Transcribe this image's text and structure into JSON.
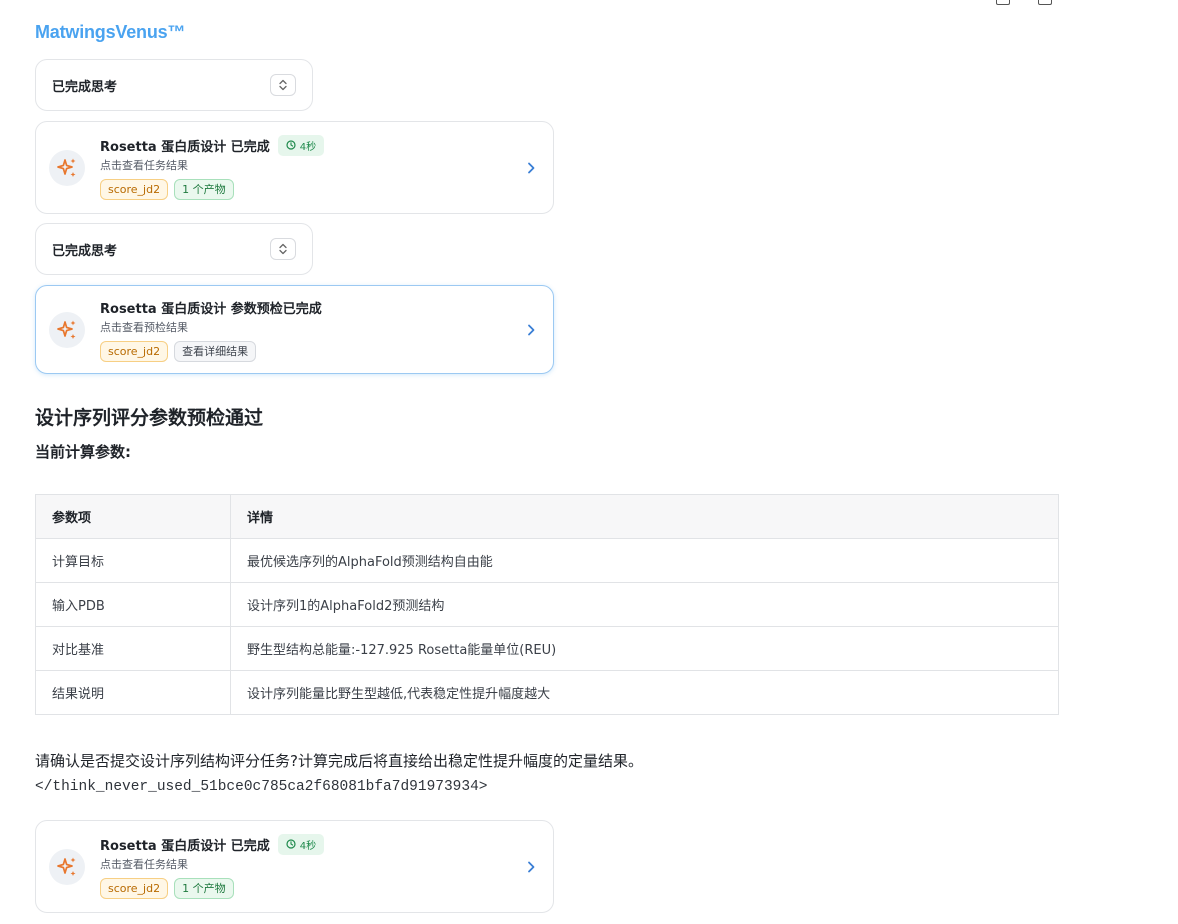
{
  "brand": "MatwingsVenus™",
  "thinking": [
    {
      "label": "已完成思考"
    },
    {
      "label": "已完成思考"
    }
  ],
  "cards": [
    {
      "title": "Rosetta 蛋白质设计 已完成",
      "time": "4秒",
      "subtitle": "点击查看任务结果",
      "tags": [
        "score_jd2",
        "1 个产物"
      ]
    },
    {
      "title": "Rosetta 蛋白质设计 参数预检已完成",
      "subtitle": "点击查看预检结果",
      "tags": [
        "score_jd2",
        "查看详细结果"
      ]
    },
    {
      "title": "Rosetta 蛋白质设计 已完成",
      "time": "4秒",
      "subtitle": "点击查看任务结果",
      "tags": [
        "score_jd2",
        "1 个产物"
      ]
    }
  ],
  "report": {
    "heading": "设计序列评分参数预检通过",
    "subheading": "当前计算参数:",
    "table": {
      "headers": [
        "参数项",
        "详情"
      ],
      "rows": [
        [
          "计算目标",
          "最优候选序列的AlphaFold预测结构自由能"
        ],
        [
          "输入PDB",
          "设计序列1的AlphaFold2预测结构"
        ],
        [
          "对比基准",
          "野生型结构总能量:-127.925 Rosetta能量单位(REU)"
        ],
        [
          "结果说明",
          "设计序列能量比野生型越低,代表稳定性提升幅度越大"
        ]
      ]
    },
    "confirm": "请确认是否提交设计序列结构评分任务?计算完成后将直接给出稳定性提升幅度的定量结果。",
    "think_tag": "</think_never_used_51bce0c785ca2f68081bfa7d91973934>"
  },
  "colors": {
    "brand": "#4aa3f0",
    "icon_accent": "#e8772e",
    "chevron": "#3a7fd5"
  }
}
